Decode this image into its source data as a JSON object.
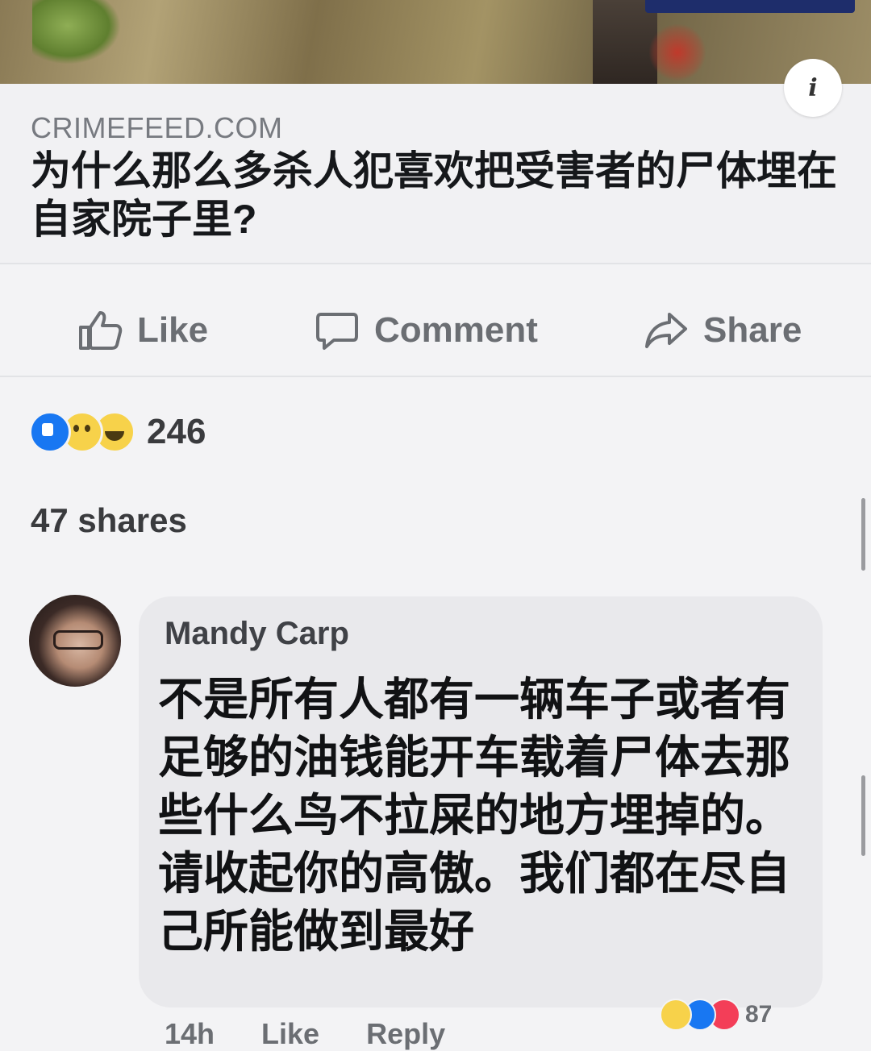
{
  "post": {
    "link": {
      "domain": "CRIMEFEED.COM",
      "headline": "为什么那么多杀人犯喜欢把受害者的尸体埋在自家院子里?"
    },
    "actions": {
      "like_label": "Like",
      "comment_label": "Comment",
      "share_label": "Share"
    },
    "stats": {
      "reactions_count": "246",
      "shares_label": "47 shares"
    }
  },
  "comment": {
    "author": "Mandy Carp",
    "text": "不是所有人都有一辆车子或者有足够的油钱能开车载着尸体去那些什么鸟不拉屎的地方埋掉的。请收起你的高傲。我们都在尽自己所能做到最好",
    "reactions_count": "87",
    "meta": {
      "time": "14h",
      "like_label": "Like",
      "reply_label": "Reply"
    }
  },
  "icons": {
    "info": "info-icon",
    "like": "thumbs-up-icon",
    "comment": "comment-bubble-icon",
    "share": "share-arrow-icon"
  },
  "colors": {
    "like_blue": "#1877f2",
    "action_gray": "#6b6e73",
    "bubble_bg": "#e9e9ec"
  }
}
